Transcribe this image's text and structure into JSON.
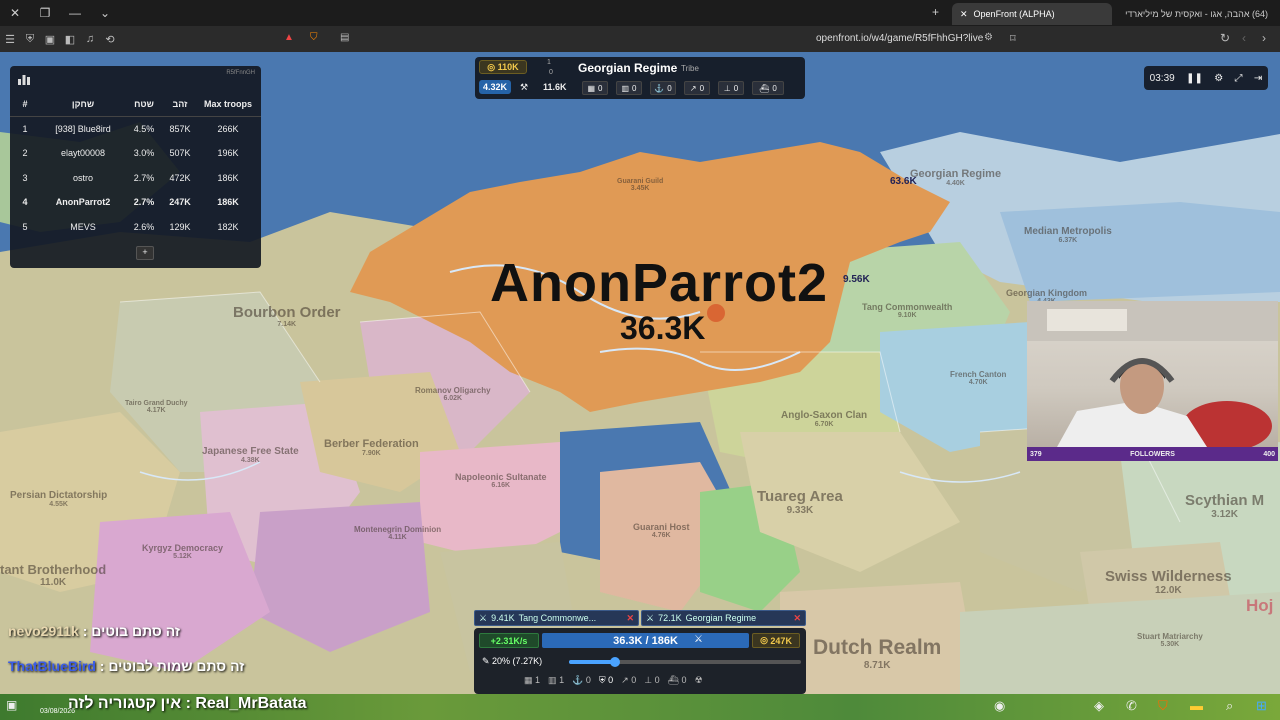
{
  "browser": {
    "active_tab": "OpenFront (ALPHA)",
    "other_tab": "(64) אהבה, אגו - ואקסית של מיליארדי",
    "url": "openfront.io/w4/game/R5fFhhGH?live"
  },
  "leaderboard": {
    "game_id": "R5fFnnGH",
    "headers": [
      "#",
      "שחקן",
      "שטח",
      "זהב",
      "Max troops"
    ],
    "rows": [
      {
        "rank": "1",
        "player": "[938] Blue8ird",
        "area": "4.5%",
        "gold": "857K",
        "max_troops": "266K"
      },
      {
        "rank": "2",
        "player": "elayt00008",
        "area": "3.0%",
        "gold": "507K",
        "max_troops": "196K"
      },
      {
        "rank": "3",
        "player": "ostro",
        "area": "2.7%",
        "gold": "472K",
        "max_troops": "186K"
      },
      {
        "rank": "4",
        "player": "AnonParrot2",
        "area": "2.7%",
        "gold": "247K",
        "max_troops": "186K"
      },
      {
        "rank": "5",
        "player": "MEVS",
        "area": "2.6%",
        "gold": "129K",
        "max_troops": "182K"
      }
    ],
    "add_label": "+"
  },
  "player_info": {
    "gold": "110K",
    "alliance_count": "1",
    "alliance_sub": "0",
    "name": "Georgian Regime",
    "type": "Tribe",
    "troops": "4.32K",
    "workers": "11.6K",
    "stats": [
      "0",
      "0",
      "0",
      "0",
      "0",
      "0"
    ]
  },
  "timer": {
    "time": "03:39"
  },
  "map": {
    "main_player": "AnonParrot2",
    "main_troops": "36.3K",
    "labels": [
      {
        "name": "Bourbon Order",
        "num": "7.14K"
      },
      {
        "name": "Georgian Regime",
        "num": "4.40K"
      },
      {
        "name": "Median Metropolis",
        "num": "6.37K"
      },
      {
        "name": "Georgian Kingdom",
        "num": "4.43K"
      },
      {
        "name": "Tang Commonwealth",
        "num": "9.10K"
      },
      {
        "name": "Romanov Oligarchy",
        "num": "6.02K"
      },
      {
        "name": "Berber Federation",
        "num": "7.90K"
      },
      {
        "name": "Japanese Free State",
        "num": "4.38K"
      },
      {
        "name": "Napoleonic Sultanate",
        "num": "6.16K"
      },
      {
        "name": "Anglo-Saxon Clan",
        "num": "6.70K"
      },
      {
        "name": "French Canton",
        "num": "4.70K"
      },
      {
        "name": "Tuareg Area",
        "num": "9.33K"
      },
      {
        "name": "Persian Dictatorship",
        "num": "4.55K"
      },
      {
        "name": "Kyrgyz Democracy",
        "num": "5.12K"
      },
      {
        "name": "Montenegrin Dominion",
        "num": "4.11K"
      },
      {
        "name": "Guarani Host",
        "num": "4.76K"
      },
      {
        "name": "tant Brotherhood",
        "num": "11.0K"
      },
      {
        "name": "Swiss Wilderness",
        "num": "12.0K"
      },
      {
        "name": "Scythian M",
        "num": "3.12K"
      },
      {
        "name": "Dutch Realm",
        "num": "8.71K"
      },
      {
        "name": "Stuart Matriarchy",
        "num": "5.30K"
      },
      {
        "name": "Tairo Grand Duchy",
        "num": "4.17K"
      },
      {
        "name": "Guarani Guild",
        "num": "3.45K"
      },
      {
        "name": "Hoj",
        "num": ""
      }
    ],
    "attack_markers": [
      "63.6K",
      "9.56K"
    ]
  },
  "webcam": {
    "followers_label": "FOLLOWERS",
    "followers_min": "379",
    "followers_max": "400"
  },
  "chat": [
    {
      "user": "nevo2911k",
      "message": ": זה סתם בוטים"
    },
    {
      "user": "ThatBlueBird",
      "message": ": זה סתם שמות לבוטים"
    }
  ],
  "attacks": [
    {
      "troops": "9.41K",
      "target": "Tang Commonwe..."
    },
    {
      "troops": "72.1K",
      "target": "Georgian Regime"
    }
  ],
  "controls": {
    "rate": "+2.31K/s",
    "troops": "36.3K / 186K",
    "gold": "247K",
    "attack_ratio": "20% (7.27K)",
    "attack_ratio_value": 20,
    "units": [
      "1",
      "1",
      "0",
      "0",
      "0",
      "0",
      "0"
    ]
  },
  "taskbar": {
    "text": "אין קטגוריה לזה : Real_MrBatata",
    "time": "03/08/2026"
  }
}
